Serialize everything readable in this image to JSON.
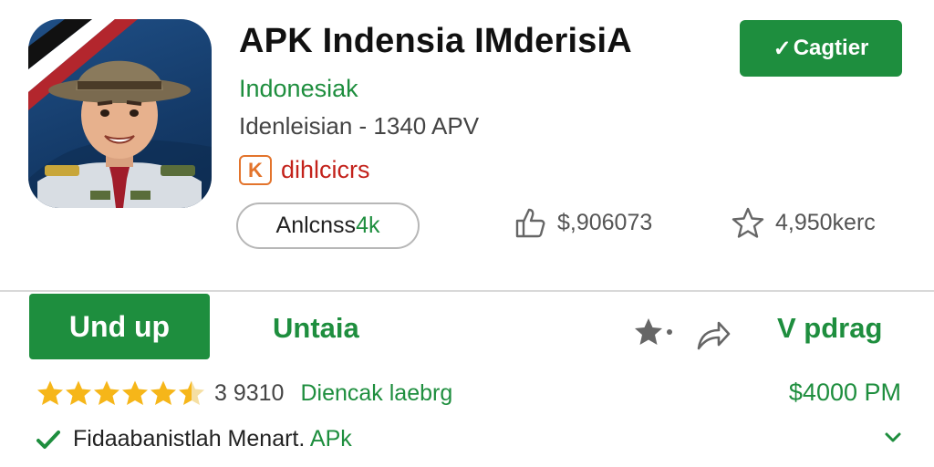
{
  "app": {
    "title": "APK Indensia IMderisiA",
    "developer": "Indonesiak",
    "meta": "Idenleisian  -  1340 APV",
    "badge_letter": "K",
    "badge_label": "dihlcicrs",
    "chip_main": "Anlcnss",
    "chip_suffix": "4k"
  },
  "stats": {
    "likes": "$,906073",
    "stars": "4,950kerc"
  },
  "header_button": {
    "check": "✓",
    "label": "Cagtier"
  },
  "actions": {
    "install_label": "Und up",
    "secondary_label": "Untaia",
    "right_label": "V pdrag"
  },
  "rating": {
    "stars_full": 5,
    "stars_half": 1,
    "count": "3 9310",
    "link": "Diencak laebrg"
  },
  "price": "$4000 PM",
  "verify": {
    "text": "Fidaabanistlah Menart.",
    "suffix": "APk"
  },
  "colors": {
    "accent_green": "#1e8e3e",
    "badge_red": "#c3221b",
    "badge_orange": "#e3742c",
    "star_gold": "#f6b619"
  },
  "icons": [
    "app-icon-ranger",
    "badge-k-icon",
    "thumb-up-icon",
    "star-outline-icon",
    "check-icon",
    "wishlist-star-icon",
    "share-arrow-icon",
    "chevron-down-icon"
  ]
}
